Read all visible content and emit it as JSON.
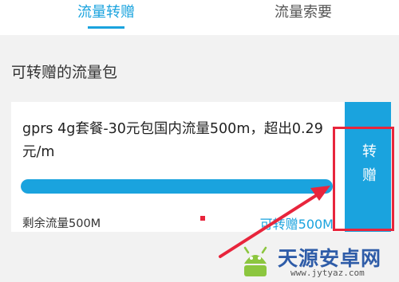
{
  "tabs": [
    {
      "label": "流量转赠",
      "active": true
    },
    {
      "label": "流量索要",
      "active": false
    }
  ],
  "section_title": "可转赠的流量包",
  "package": {
    "name": "gprs 4g套餐-30元包国内流量500m，超出0.29元/m",
    "progress_fraction": 1.0,
    "remaining_label": "剩余流量500M",
    "transferable_label": "可转赠500M"
  },
  "transfer_button": {
    "label": "转赠"
  },
  "watermark": {
    "title": "天源安卓网",
    "url": "www.jytyaz.com"
  },
  "colors": {
    "accent": "#1aa3de",
    "annotation_red": "#e8253c"
  }
}
